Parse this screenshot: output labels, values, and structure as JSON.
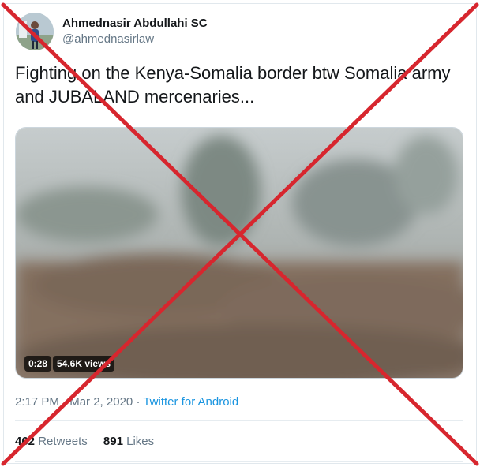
{
  "tweet": {
    "author_name": "Ahmednasir Abdullahi SC",
    "handle": "@ahmednasirlaw",
    "text": "Fighting on the Kenya-Somalia border btw Somalia army and JUBALAND mercenaries...",
    "video": {
      "duration": "0:28",
      "views": "54.6K views"
    },
    "time": "2:17 PM",
    "separator": "·",
    "date": "Mar 2, 2020",
    "source": "Twitter for Android",
    "retweets_count": "462",
    "retweets_label": "Retweets",
    "likes_count": "891",
    "likes_label": "Likes"
  },
  "overlay": {
    "mark": "cross-out",
    "color": "#d7262e"
  },
  "colors": {
    "text": "#14171a",
    "secondary": "#657786",
    "link": "#1b95e0"
  }
}
